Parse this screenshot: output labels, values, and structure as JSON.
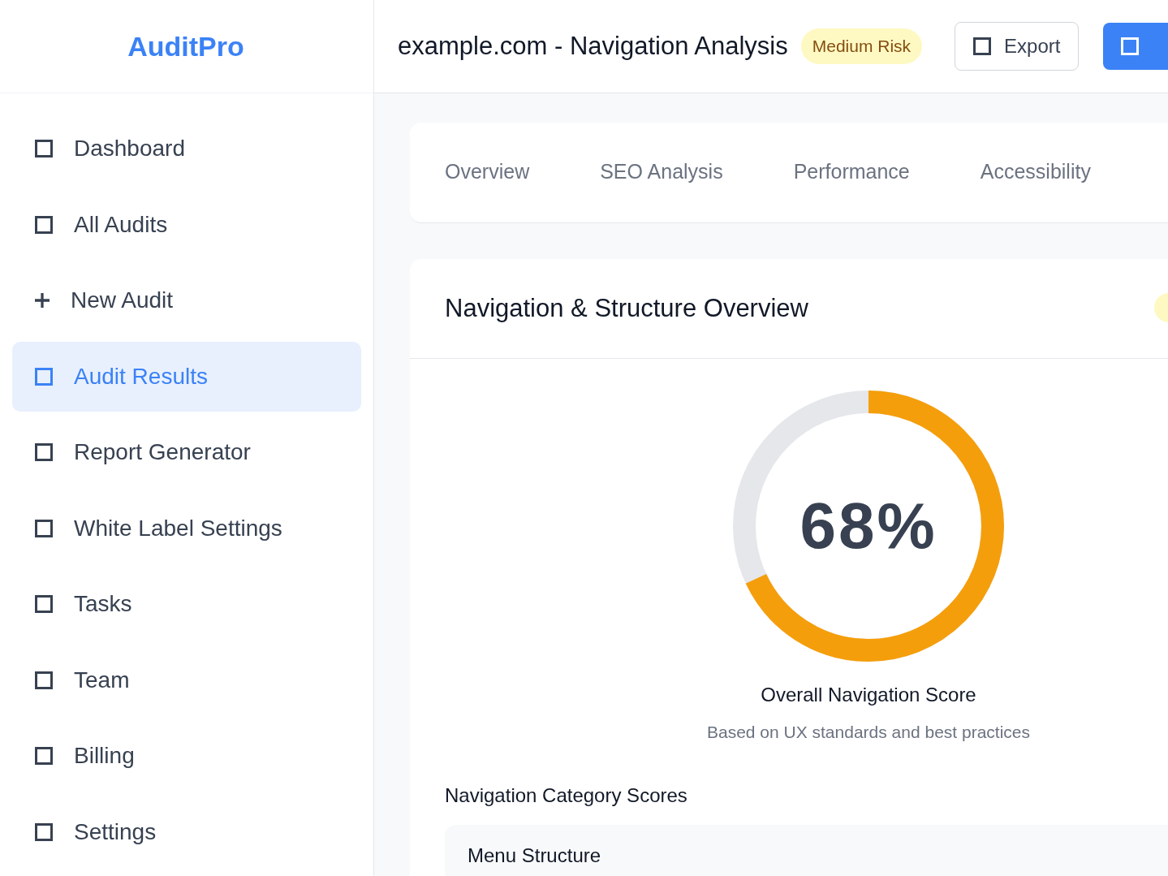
{
  "brand": "AuditPro",
  "sidebar": {
    "items": [
      {
        "label": "Dashboard",
        "selected": false
      },
      {
        "label": "All Audits",
        "selected": false
      },
      {
        "label": "New Audit",
        "selected": false
      },
      {
        "label": "Audit Results",
        "selected": true
      },
      {
        "label": "Report Generator",
        "selected": false
      },
      {
        "label": "White Label Settings",
        "selected": false
      },
      {
        "label": "Tasks",
        "selected": false
      },
      {
        "label": "Team",
        "selected": false
      },
      {
        "label": "Billing",
        "selected": false
      },
      {
        "label": "Settings",
        "selected": false
      }
    ]
  },
  "header": {
    "title": "example.com - Navigation Analysis",
    "risk_badge": "Medium Risk",
    "export_button": "Export"
  },
  "tabs": [
    {
      "label": "Overview",
      "selected": false
    },
    {
      "label": "SEO Analysis",
      "selected": false
    },
    {
      "label": "Performance",
      "selected": false
    },
    {
      "label": "Accessibility",
      "selected": false
    }
  ],
  "card": {
    "title": "Navigation & Structure Overview",
    "score": {
      "text": "68%",
      "level": 0.68,
      "label": "Overall Navigation Score",
      "caption": "Based on UX standards and best practices"
    },
    "section_title": "Navigation Category Scores",
    "categories": [
      {
        "name": "Menu Structure"
      }
    ]
  }
}
